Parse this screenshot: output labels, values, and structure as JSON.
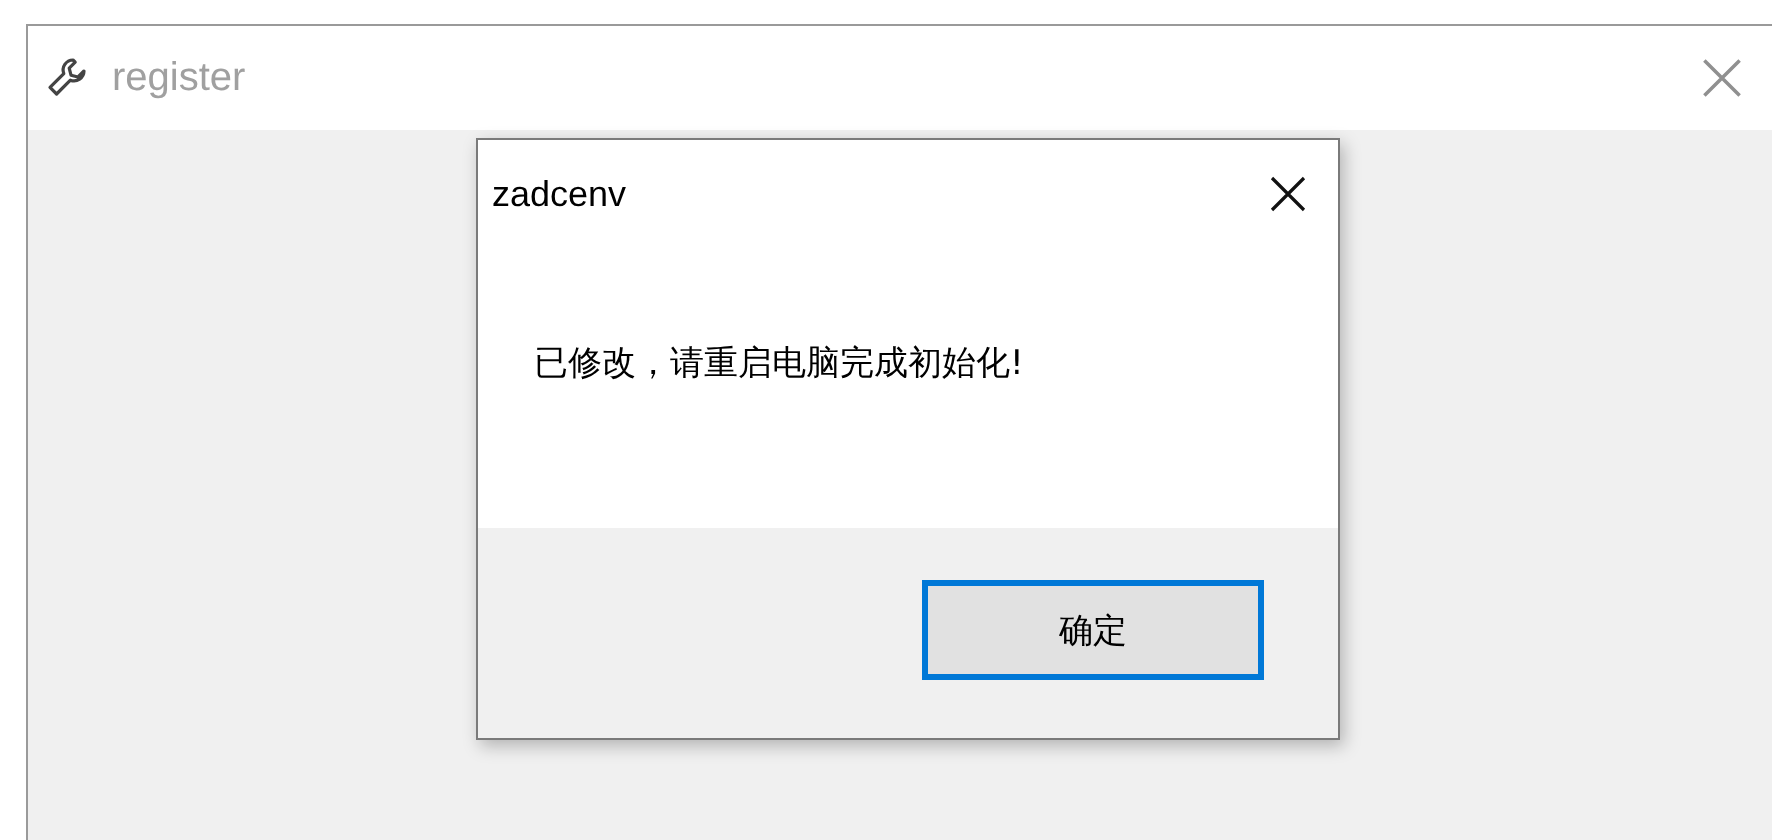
{
  "window": {
    "title": "register"
  },
  "dialog": {
    "title": "zadcenv",
    "message": "已修改，请重启电脑完成初始化!",
    "buttons": [
      {
        "label": "确定",
        "focused": true
      }
    ]
  }
}
